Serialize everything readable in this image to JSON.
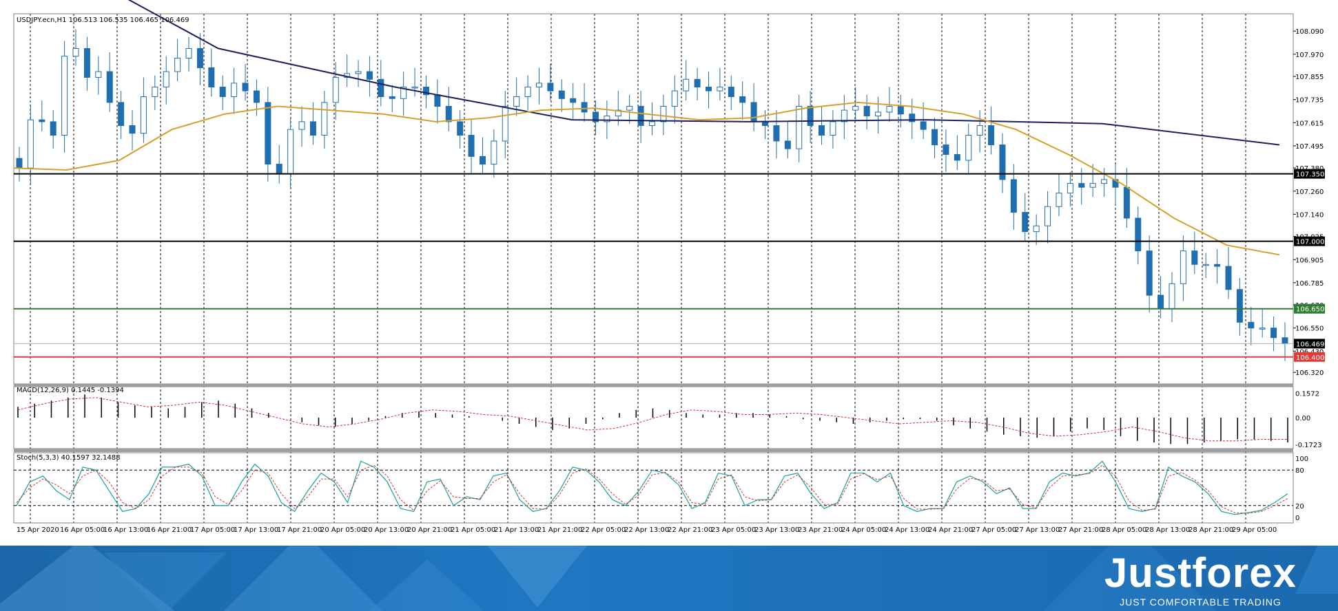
{
  "chart_data": [
    {
      "type": "candlestick",
      "title": "USDJPY.ecn,H1  106.513 106.535 106.465 106.469",
      "symbol": "USDJPY.ecn,H1",
      "ohlc_header": [
        "106.513",
        "106.535",
        "106.465",
        "106.469"
      ],
      "ylim": [
        106.26,
        108.18
      ],
      "y_ticks": [
        "108.090",
        "107.970",
        "107.855",
        "107.735",
        "107.615",
        "107.495",
        "107.380",
        "107.260",
        "107.140",
        "107.025",
        "106.905",
        "106.785",
        "106.670",
        "106.550",
        "106.430",
        "106.320"
      ],
      "x_ticks": [
        "15 Apr 2020",
        "16 Apr 05:00",
        "16 Apr 13:00",
        "16 Apr 21:00",
        "17 Apr 05:00",
        "17 Apr 13:00",
        "17 Apr 21:00",
        "20 Apr 05:00",
        "20 Apr 13:00",
        "20 Apr 21:00",
        "21 Apr 05:00",
        "21 Apr 13:00",
        "21 Apr 21:00",
        "22 Apr 05:00",
        "22 Apr 13:00",
        "22 Apr 21:00",
        "23 Apr 05:00",
        "23 Apr 13:00",
        "23 Apr 21:00",
        "24 Apr 05:00",
        "24 Apr 13:00",
        "24 Apr 21:00",
        "27 Apr 05:00",
        "27 Apr 13:00",
        "27 Apr 21:00",
        "28 Apr 05:00",
        "28 Apr 13:00",
        "28 Apr 21:00",
        "29 Apr 05:00"
      ],
      "close_path": [
        107.38,
        107.63,
        107.62,
        107.55,
        107.96,
        108.0,
        107.85,
        107.88,
        107.72,
        107.6,
        107.56,
        107.75,
        107.8,
        107.88,
        107.95,
        108.0,
        107.9,
        107.8,
        107.75,
        107.82,
        107.78,
        107.72,
        107.4,
        107.35,
        107.58,
        107.62,
        107.55,
        107.72,
        107.85,
        107.87,
        107.88,
        107.84,
        107.75,
        107.74,
        107.8,
        107.8,
        107.76,
        107.7,
        107.62,
        107.55,
        107.44,
        107.4,
        107.52,
        107.7,
        107.75,
        107.8,
        107.82,
        107.78,
        107.74,
        107.72,
        107.67,
        107.62,
        107.65,
        107.68,
        107.7,
        107.6,
        107.62,
        107.7,
        107.78,
        107.84,
        107.8,
        107.78,
        107.8,
        107.75,
        107.72,
        107.62,
        107.6,
        107.52,
        107.48,
        107.7,
        107.6,
        107.55,
        107.62,
        107.68,
        107.7,
        107.65,
        107.67,
        107.7,
        107.66,
        107.62,
        107.58,
        107.5,
        107.45,
        107.42,
        107.55,
        107.6,
        107.5,
        107.32,
        107.15,
        107.05,
        107.08,
        107.18,
        107.25,
        107.3,
        107.28,
        107.3,
        107.32,
        107.28,
        107.12,
        106.95,
        106.72,
        106.65,
        106.78,
        106.95,
        106.88,
        106.88,
        106.87,
        106.75,
        106.58,
        106.55,
        106.55,
        106.5,
        106.469
      ],
      "last_price": "106.469",
      "series": [
        {
          "name": "",
          "color": "#1a1f5e",
          "values": [
            108.5,
            108.0,
            107.8,
            107.63,
            107.62,
            107.63,
            107.61,
            107.5
          ]
        },
        {
          "name": "",
          "color": "#d4a02a",
          "values": [
            107.38,
            107.37,
            107.42,
            107.58,
            107.66,
            107.7,
            107.68,
            107.66,
            107.62,
            107.64,
            107.68,
            107.69,
            107.66,
            107.63,
            107.64,
            107.69,
            107.72,
            107.7,
            107.66,
            107.58,
            107.45,
            107.3,
            107.12,
            106.98,
            106.93
          ]
        }
      ],
      "levels": [
        {
          "value": 107.35,
          "label": "107.350",
          "color": "#000000",
          "label_bg": "#000000"
        },
        {
          "value": 107.0,
          "label": "107.000",
          "color": "#000000",
          "label_bg": "#000000"
        },
        {
          "value": 106.65,
          "label": "106.650",
          "color": "#2e7d32",
          "label_bg": "#2e7d32"
        },
        {
          "value": 106.4,
          "label": "106.400",
          "color": "#e53935",
          "label_bg": "#e53935"
        }
      ]
    },
    {
      "type": "bar",
      "title": "MACD(12,26,9)  0.1445 -0.1394",
      "y_ticks": [
        "0.1572",
        "0.00",
        "-0.1723"
      ],
      "ylim": [
        -0.2,
        0.2
      ],
      "histogram": [
        0.07,
        0.09,
        0.11,
        0.13,
        0.15,
        0.13,
        0.1,
        0.08,
        0.07,
        0.06,
        0.07,
        0.1,
        0.11,
        0.09,
        0.06,
        0.03,
        0.0,
        -0.03,
        -0.05,
        -0.06,
        -0.04,
        -0.02,
        0.01,
        0.03,
        0.04,
        0.03,
        0.02,
        0.01,
        0.0,
        -0.02,
        -0.04,
        -0.06,
        -0.08,
        -0.07,
        -0.04,
        -0.01,
        0.03,
        0.05,
        0.06,
        0.05,
        0.03,
        0.02,
        0.02,
        0.03,
        0.03,
        0.02,
        0.01,
        -0.01,
        -0.02,
        -0.03,
        -0.04,
        -0.03,
        -0.02,
        -0.01,
        -0.01,
        -0.02,
        -0.05,
        -0.07,
        -0.09,
        -0.11,
        -0.12,
        -0.13,
        -0.12,
        -0.09,
        -0.07,
        -0.08,
        -0.12,
        -0.15,
        -0.16,
        -0.17,
        -0.17,
        -0.16,
        -0.15,
        -0.14,
        -0.14,
        -0.15,
        -0.16
      ],
      "signal": [
        0.05,
        0.09,
        0.12,
        0.13,
        0.1,
        0.07,
        0.08,
        0.1,
        0.08,
        0.04,
        0.0,
        -0.04,
        -0.06,
        -0.04,
        -0.01,
        0.03,
        0.05,
        0.04,
        0.02,
        0.01,
        -0.02,
        -0.05,
        -0.08,
        -0.07,
        -0.03,
        0.02,
        0.05,
        0.04,
        0.02,
        0.02,
        0.03,
        0.02,
        0.0,
        -0.02,
        -0.04,
        -0.03,
        -0.02,
        -0.03,
        -0.06,
        -0.1,
        -0.12,
        -0.11,
        -0.09,
        -0.06,
        -0.09,
        -0.13,
        -0.15,
        -0.15,
        -0.14,
        -0.14
      ]
    },
    {
      "type": "line",
      "title": "Stoch(5,3,3)  40.1597 32.1488",
      "y_ticks": [
        "100",
        "80",
        "20",
        "0"
      ],
      "ylim": [
        0,
        100
      ],
      "main": [
        20,
        60,
        70,
        45,
        30,
        85,
        80,
        45,
        10,
        15,
        40,
        85,
        85,
        90,
        70,
        20,
        20,
        60,
        90,
        70,
        25,
        10,
        45,
        75,
        60,
        25,
        95,
        85,
        60,
        15,
        10,
        60,
        65,
        20,
        35,
        30,
        70,
        75,
        30,
        10,
        15,
        45,
        85,
        80,
        60,
        30,
        20,
        45,
        80,
        75,
        55,
        15,
        25,
        75,
        70,
        20,
        30,
        30,
        70,
        75,
        40,
        15,
        25,
        75,
        75,
        60,
        75,
        20,
        10,
        15,
        15,
        60,
        70,
        60,
        40,
        50,
        15,
        15,
        60,
        75,
        70,
        75,
        95,
        60,
        15,
        10,
        15,
        85,
        70,
        60,
        40,
        10,
        5,
        8,
        12,
        25,
        40
      ],
      "signal": [
        25,
        50,
        65,
        55,
        40,
        70,
        80,
        60,
        25,
        15,
        30,
        70,
        85,
        85,
        75,
        35,
        22,
        45,
        80,
        75,
        40,
        15,
        35,
        65,
        65,
        35,
        80,
        88,
        70,
        30,
        12,
        45,
        62,
        35,
        32,
        32,
        60,
        72,
        40,
        15,
        14,
        38,
        75,
        82,
        65,
        40,
        22,
        38,
        72,
        76,
        60,
        25,
        22,
        65,
        72,
        35,
        28,
        30,
        60,
        72,
        50,
        22,
        22,
        65,
        74,
        64,
        70,
        32,
        14,
        14,
        15,
        48,
        66,
        63,
        45,
        48,
        22,
        16,
        50,
        70,
        72,
        74,
        88,
        70,
        28,
        12,
        14,
        70,
        76,
        63,
        45,
        18,
        8,
        7,
        10,
        20,
        32
      ]
    }
  ],
  "brand": {
    "name": "Justforex",
    "tagline": "JUST COMFORTABLE TRADING"
  }
}
